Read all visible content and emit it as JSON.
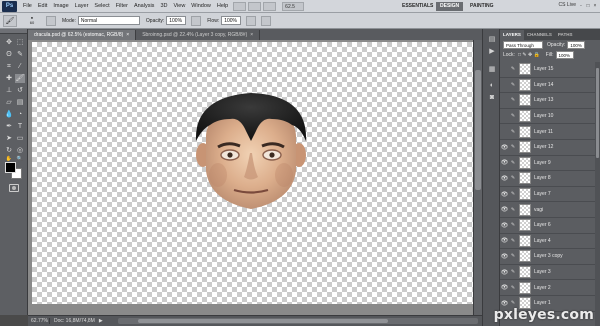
{
  "menubar": {
    "app_logo": "Ps",
    "items": [
      "File",
      "Edit",
      "Image",
      "Layer",
      "Select",
      "Filter",
      "Analysis",
      "3D",
      "View",
      "Window",
      "Help"
    ],
    "zoom": "62.5",
    "workspaces": [
      "ESSENTIALS",
      "DESIGN",
      "PAINTING"
    ],
    "active_workspace": "DESIGN",
    "cs_live": "CS Live",
    "window_controls": [
      "-",
      "□",
      "×"
    ]
  },
  "options": {
    "brush_size": "60",
    "mode_label": "Mode:",
    "mode_value": "Normal",
    "opacity_label": "Opacity:",
    "opacity_value": "100%",
    "flow_label": "Flow:",
    "flow_value": "100%"
  },
  "tabs": [
    {
      "label": "dracula.psd @ 62.5% (estomac, RGB/8)",
      "active": true
    },
    {
      "label": "Sbroinng.psd @ 22.4% (Layer 3 copy, RGB/8#)",
      "active": false
    }
  ],
  "status": {
    "zoom": "62.77%",
    "doc": "Doc: 16,8M/74,8M"
  },
  "panel": {
    "tabs": [
      "LAYERS",
      "CHANNELS",
      "PATHS"
    ],
    "blend_mode": "Pass Through",
    "opacity_label": "Opacity:",
    "opacity_value": "100%",
    "lock_label": "Lock:",
    "fill_label": "Fill:",
    "fill_value": "100%"
  },
  "layers": [
    {
      "name": "Layer 15",
      "visible": false
    },
    {
      "name": "Layer 14",
      "visible": false
    },
    {
      "name": "Layer 13",
      "visible": false
    },
    {
      "name": "Layer 10",
      "visible": false
    },
    {
      "name": "Layer 11",
      "visible": false
    },
    {
      "name": "Layer 12",
      "visible": true
    },
    {
      "name": "Layer 9",
      "visible": true
    },
    {
      "name": "Layer 8",
      "visible": true
    },
    {
      "name": "Layer 7",
      "visible": true
    },
    {
      "name": "vagi",
      "visible": true
    },
    {
      "name": "Layer 6",
      "visible": true
    },
    {
      "name": "Layer 4",
      "visible": true
    },
    {
      "name": "Layer 3 copy",
      "visible": true
    },
    {
      "name": "Layer 3",
      "visible": true
    },
    {
      "name": "Layer 2",
      "visible": true
    },
    {
      "name": "Layer 1",
      "visible": true
    }
  ],
  "watermark": "pxleyes.com"
}
